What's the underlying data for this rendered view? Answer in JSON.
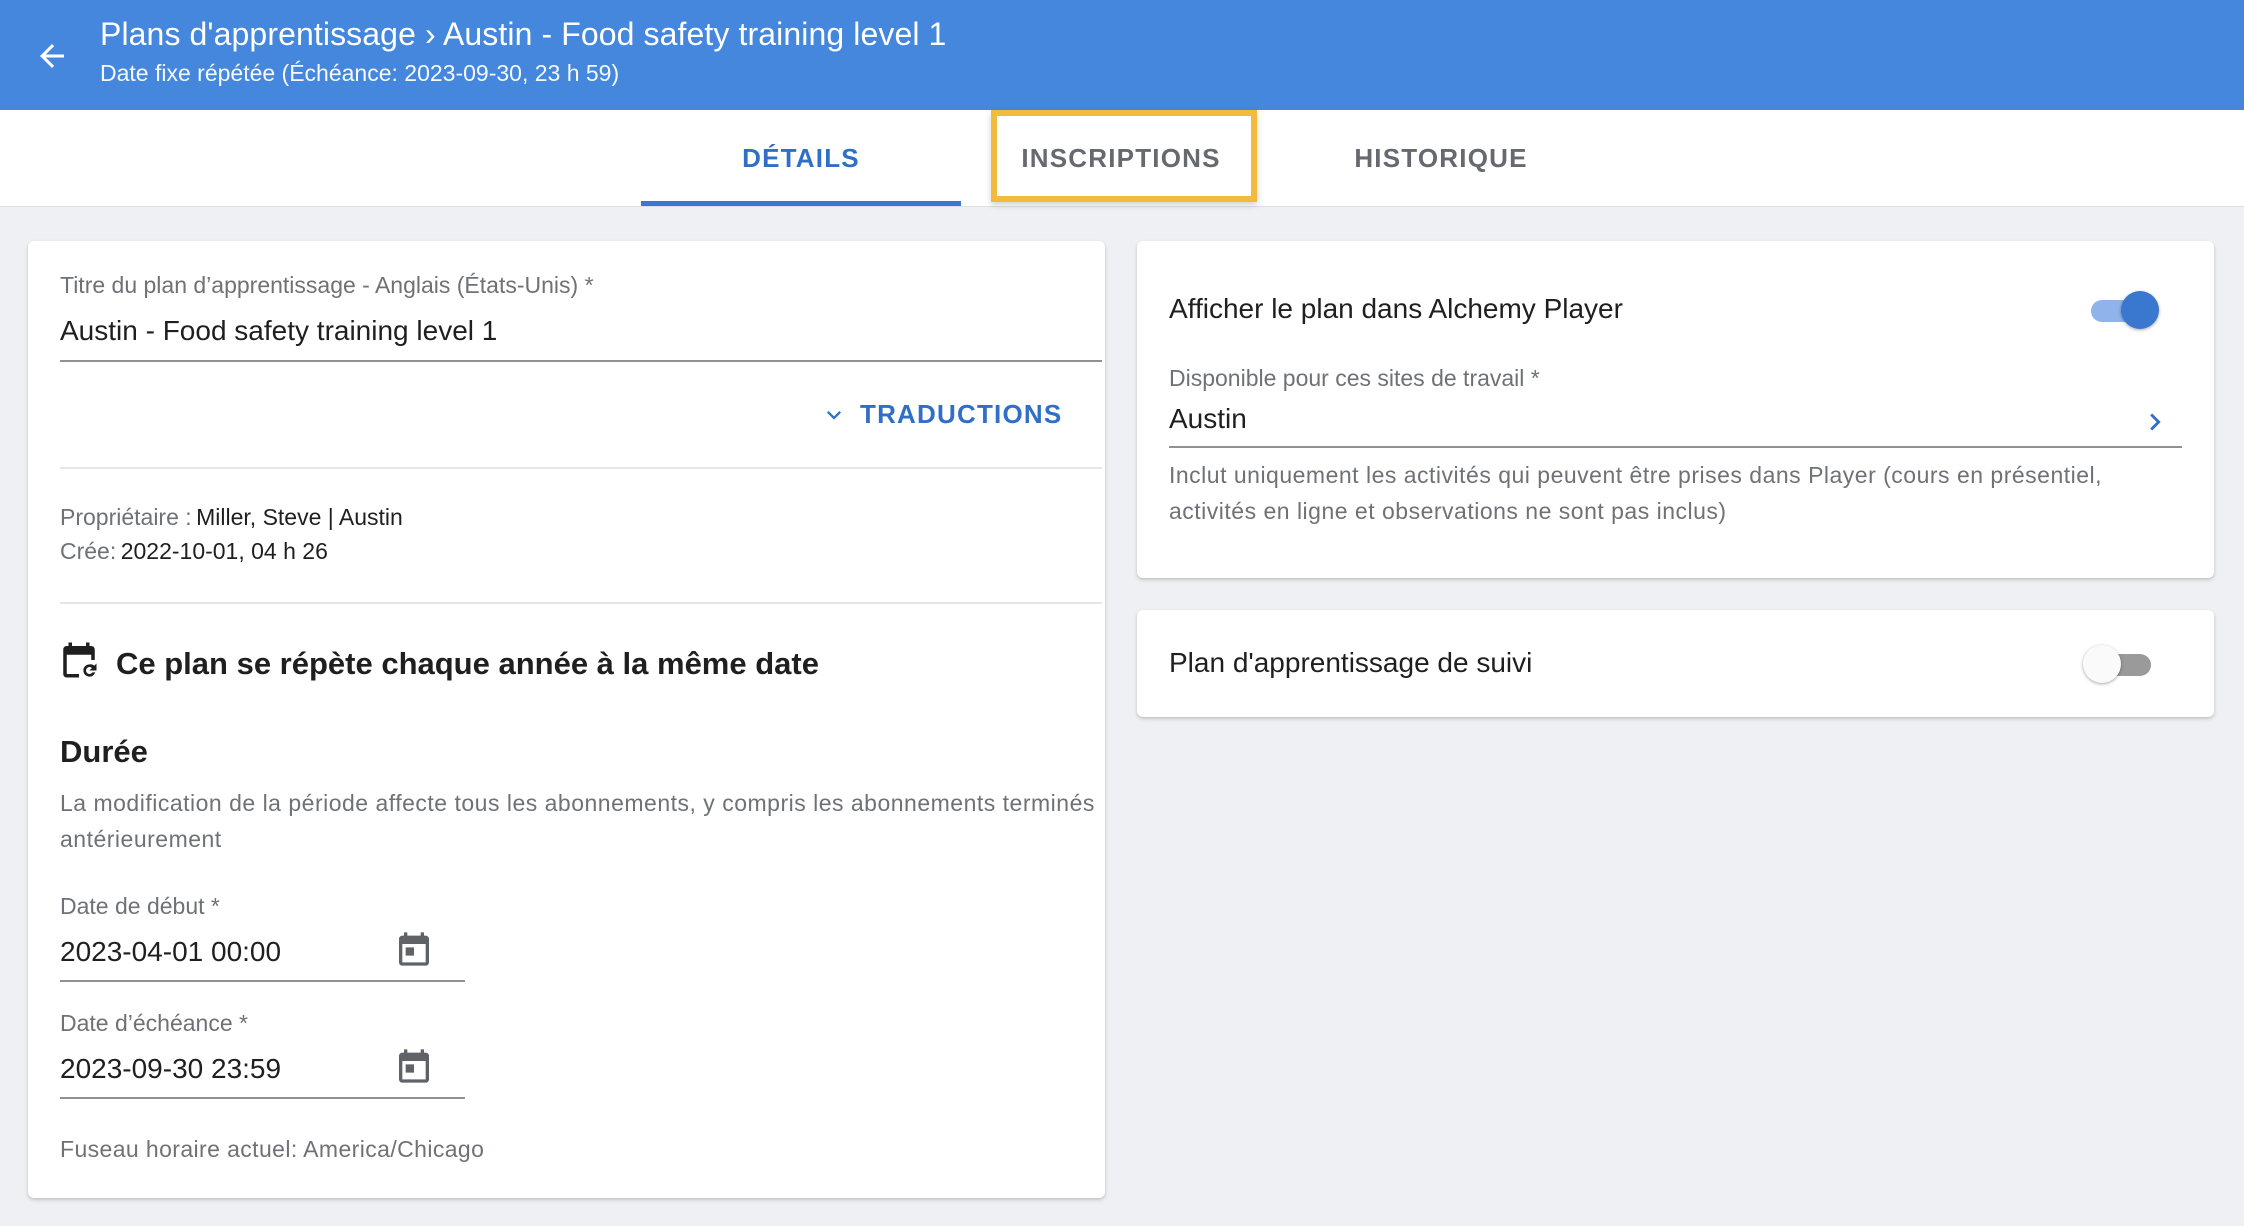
{
  "header": {
    "title": "Plans d'apprentissage › Austin - Food safety training level 1",
    "subtitle": "Date fixe répétée (Échéance: 2023-09-30, 23 h 59)"
  },
  "tabs": [
    {
      "label": "DÉTAILS",
      "active": true
    },
    {
      "label": "INSCRIPTIONS",
      "active": false,
      "highlighted": true
    },
    {
      "label": "HISTORIQUE",
      "active": false
    }
  ],
  "details": {
    "title_label": "Titre du plan d’apprentissage - Anglais (États-Unis) *",
    "title_value": "Austin - Food safety training level 1",
    "translations_label": "TRADUCTIONS",
    "owner_label": "Propriétaire :",
    "owner_value": "Miller, Steve | Austin",
    "created_label": "Crée:",
    "created_value": "2022-10-01, 04 h 26",
    "repeat_heading": "Ce plan se répète chaque année à la même date",
    "duration_heading": "Durée",
    "duration_text": "La modification de la période affecte tous les abonnements, y compris les abonnements terminés antérieurement",
    "start_label": "Date de début *",
    "start_value": "2023-04-01 00:00",
    "due_label": "Date d’échéance *",
    "due_value": "2023-09-30 23:59",
    "timezone": "Fuseau horaire actuel: America/Chicago"
  },
  "player": {
    "show_label": "Afficher le plan dans Alchemy Player",
    "show_enabled": true,
    "sites_label": "Disponible pour ces sites de travail *",
    "sites_value": "Austin",
    "note": "Inclut uniquement les activités qui peuvent être prises dans Player (cours en présentiel, activités en ligne et observations ne sont pas inclus)"
  },
  "followup": {
    "label": "Plan d'apprentissage de suivi",
    "enabled": false
  },
  "colors": {
    "header_bg": "#4487dd",
    "accent": "#2f6fc7",
    "highlight": "#f2bb3c"
  }
}
